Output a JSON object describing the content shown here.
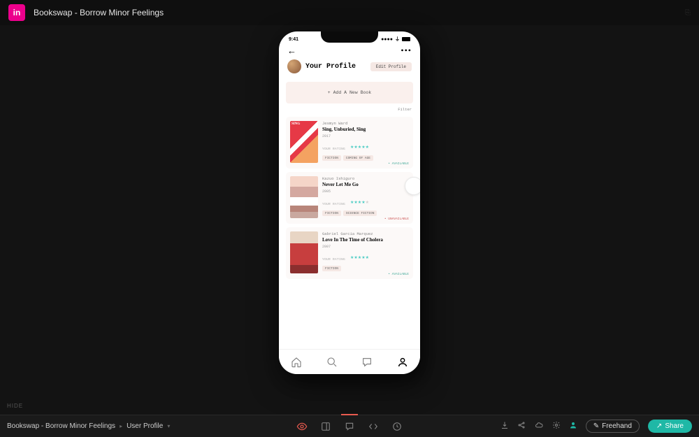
{
  "header": {
    "logo_text": "in",
    "title": "Bookswap - Borrow Minor Feelings"
  },
  "hide_label": "HIDE",
  "breadcrumb": {
    "project": "Bookswap - Borrow Minor Feelings",
    "screen": "User Profile"
  },
  "bottom_actions": {
    "freehand": "Freehand",
    "share": "Share"
  },
  "phone": {
    "status_time": "9:41",
    "profile": {
      "heading": "Your Profile",
      "edit_label": "Edit Profile",
      "add_book_label": "+ Add A New Book",
      "filter_label": "Filter"
    },
    "books": [
      {
        "author": "Jesmyn Ward",
        "title": "Sing, Unburied, Sing",
        "year": "2017",
        "rating_label": "YOUR RATING",
        "rating": 5,
        "tags": [
          "FICTION",
          "COMING OF AGE"
        ],
        "status": "• AVAILABLE",
        "status_type": "avail"
      },
      {
        "author": "Kazuo Ishiguro",
        "title": "Never Let Me Go",
        "year": "2005",
        "rating_label": "YOUR RATING",
        "rating": 4,
        "tags": [
          "FICTION",
          "SCIENCE FICTION"
        ],
        "status": "• UNAVAILABLE",
        "status_type": "unavail"
      },
      {
        "author": "Gabriel Garcia Marquez",
        "title": "Love In The Time of Cholera",
        "year": "2007",
        "rating_label": "YOUR RATING",
        "rating": 5,
        "tags": [
          "FICTION"
        ],
        "status": "• AVAILABLE",
        "status_type": "avail"
      }
    ]
  }
}
